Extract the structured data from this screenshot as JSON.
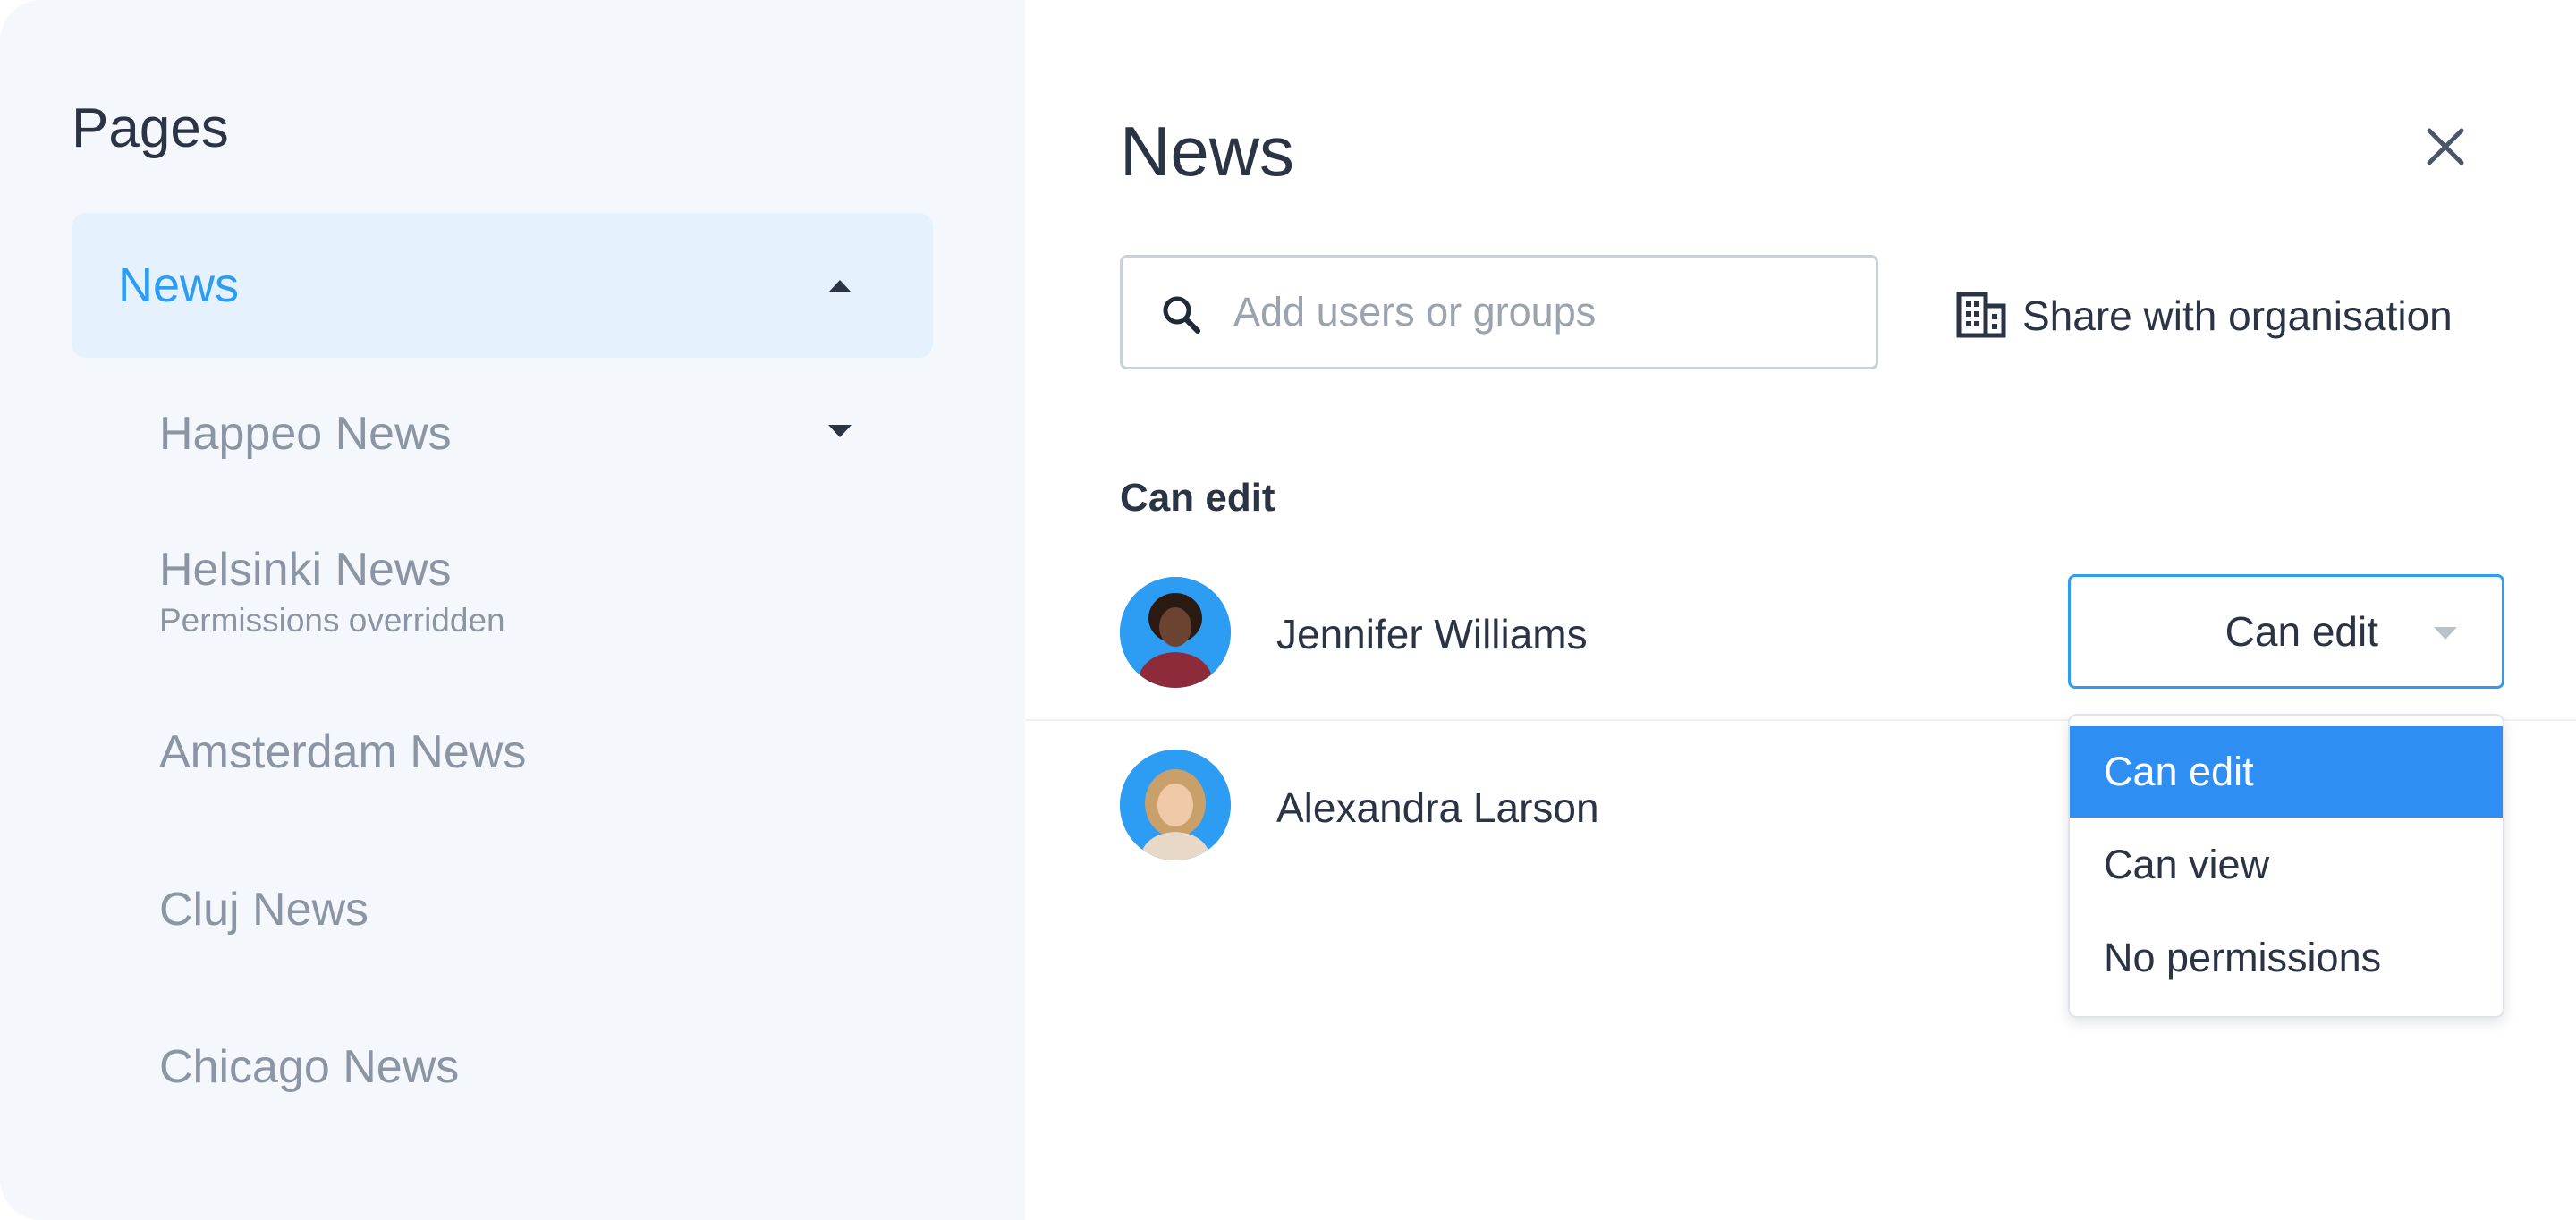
{
  "sidebar": {
    "title": "Pages",
    "active_item": "News",
    "items": [
      {
        "label": "Happeo News"
      },
      {
        "label": "Helsinki News",
        "note": "Permissions overridden"
      },
      {
        "label": "Amsterdam News"
      },
      {
        "label": "Cluj News"
      },
      {
        "label": "Chicago News"
      }
    ]
  },
  "panel": {
    "title": "News",
    "search_placeholder": "Add users or groups",
    "share_label": "Share with organisation",
    "section_label": "Can edit"
  },
  "users": [
    {
      "name": "Jennifer Williams",
      "permission": "Can edit"
    },
    {
      "name": "Alexandra Larson"
    }
  ],
  "dropdown": {
    "options": [
      "Can edit",
      "Can view",
      "No permissions"
    ],
    "selected": "Can edit"
  },
  "colors": {
    "accent": "#2d9cf3",
    "selected_option": "#2e8ef2",
    "sidebar_bg": "#f4f8fc",
    "active_item_bg": "#e5f1fd",
    "muted_text": "#8b95a3"
  },
  "icons": {
    "search": "search-icon",
    "close": "close-icon",
    "organisation": "building-icon",
    "expand": "chevron-up-icon",
    "collapse": "chevron-down-icon"
  }
}
